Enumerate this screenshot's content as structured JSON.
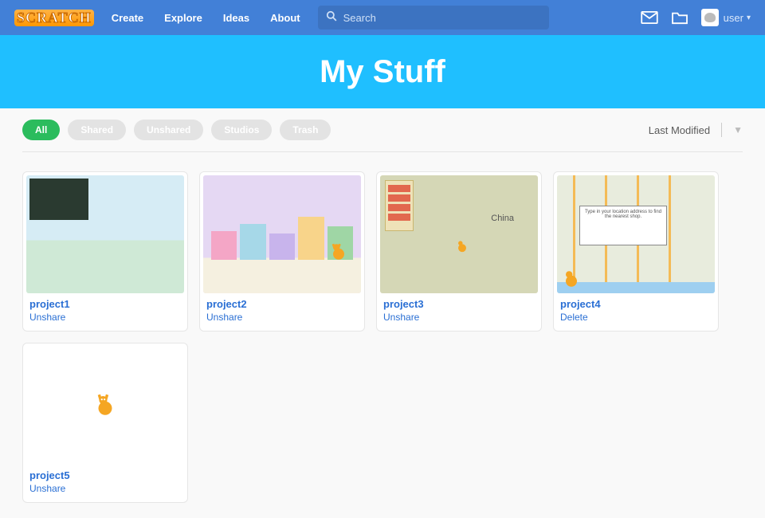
{
  "nav": {
    "logo": "SCRATCH",
    "links": {
      "create": "Create",
      "explore": "Explore",
      "ideas": "Ideas",
      "about": "About"
    },
    "search_placeholder": "Search",
    "username": "user"
  },
  "banner": {
    "title": "My Stuff"
  },
  "filters": {
    "all": "All",
    "shared": "Shared",
    "unshared": "Unshared",
    "studios": "Studios",
    "trash": "Trash",
    "active": "all"
  },
  "sort": {
    "label": "Last Modified"
  },
  "projects": [
    {
      "title": "project1",
      "action": "Unshare",
      "thumb": "map1"
    },
    {
      "title": "project2",
      "action": "Unshare",
      "thumb": "city"
    },
    {
      "title": "project3",
      "action": "Unshare",
      "thumb": "map2",
      "label": "China"
    },
    {
      "title": "project4",
      "action": "Delete",
      "thumb": "map3",
      "popup": "Type in your location address to find the nearest shop."
    },
    {
      "title": "project5",
      "action": "Unshare",
      "thumb": "blank"
    }
  ]
}
